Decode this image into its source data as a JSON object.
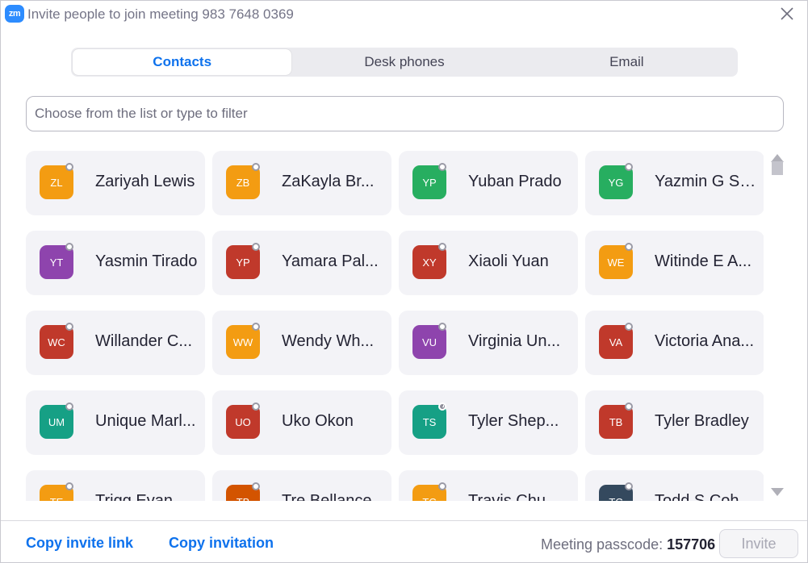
{
  "window": {
    "app_logo": "zm",
    "title": "Invite people to join meeting 983 7648 0369",
    "close_icon": "close-icon"
  },
  "tabs": [
    {
      "label": "Contacts",
      "active": true
    },
    {
      "label": "Desk phones",
      "active": false
    },
    {
      "label": "Email",
      "active": false
    }
  ],
  "search": {
    "placeholder": "Choose from the list or type to filter",
    "value": ""
  },
  "contacts": [
    {
      "initials": "ZL",
      "name": "Zariyah Lewis",
      "color": "#f39c12",
      "status": "offline"
    },
    {
      "initials": "ZB",
      "name": "ZaKayla Br...",
      "color": "#f39c12",
      "status": "offline"
    },
    {
      "initials": "YP",
      "name": "Yuban Prado",
      "color": "#27ae60",
      "status": "offline"
    },
    {
      "initials": "YG",
      "name": "Yazmin G Sa...",
      "color": "#27ae60",
      "status": "offline"
    },
    {
      "initials": "YT",
      "name": "Yasmin Tirado",
      "color": "#8e44ad",
      "status": "offline"
    },
    {
      "initials": "YP",
      "name": "Yamara Pal...",
      "color": "#c0392b",
      "status": "offline"
    },
    {
      "initials": "XY",
      "name": "Xiaoli Yuan",
      "color": "#c0392b",
      "status": "offline"
    },
    {
      "initials": "WE",
      "name": "Witinde E A...",
      "color": "#f39c12",
      "status": "offline"
    },
    {
      "initials": "WC",
      "name": "Willander C...",
      "color": "#c0392b",
      "status": "offline"
    },
    {
      "initials": "WW",
      "name": "Wendy Wh...",
      "color": "#f39c12",
      "status": "offline"
    },
    {
      "initials": "VU",
      "name": "Virginia Un...",
      "color": "#8e44ad",
      "status": "offline"
    },
    {
      "initials": "VA",
      "name": "Victoria Ana...",
      "color": "#c0392b",
      "status": "offline"
    },
    {
      "initials": "UM",
      "name": "Unique Marl...",
      "color": "#16a085",
      "status": "offline"
    },
    {
      "initials": "UO",
      "name": "Uko Okon",
      "color": "#c0392b",
      "status": "offline"
    },
    {
      "initials": "TS",
      "name": "Tyler Shep...",
      "color": "#16a085",
      "status": "away"
    },
    {
      "initials": "TB",
      "name": "Tyler Bradley",
      "color": "#c0392b",
      "status": "offline"
    },
    {
      "initials": "TE",
      "name": "Trigg Evan",
      "color": "#f39c12",
      "status": "offline"
    },
    {
      "initials": "TB",
      "name": "Tre Bellance",
      "color": "#d35400",
      "status": "offline"
    },
    {
      "initials": "TC",
      "name": "Travis Chu",
      "color": "#f39c12",
      "status": "offline"
    },
    {
      "initials": "TC",
      "name": "Todd S Coh...",
      "color": "#34495e",
      "status": "offline"
    }
  ],
  "footer": {
    "copy_invite_link": "Copy invite link",
    "copy_invitation": "Copy invitation",
    "passcode_label": "Meeting passcode:",
    "passcode_value": "157706",
    "invite_button": "Invite"
  }
}
